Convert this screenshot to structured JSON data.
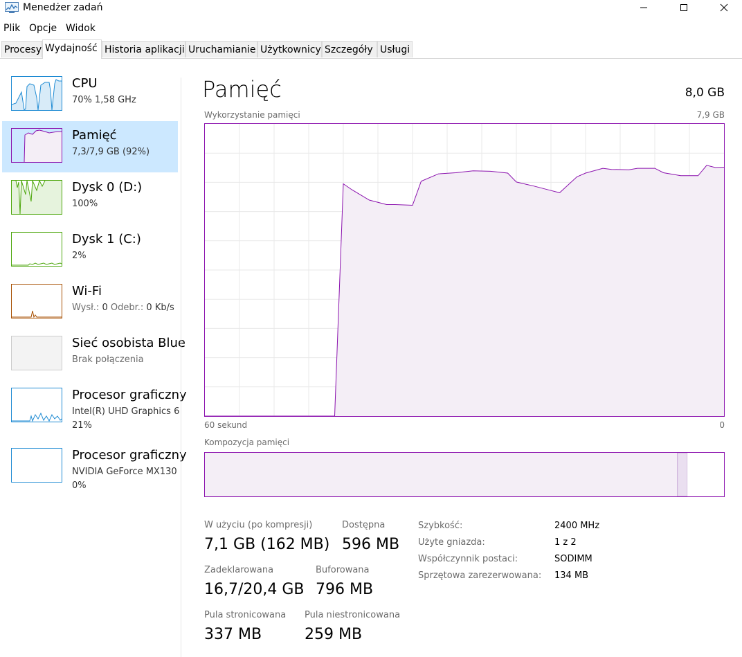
{
  "window": {
    "title": "Menedżer zadań",
    "icon": "task-manager-icon"
  },
  "menu": {
    "items": [
      "Plik",
      "Opcje",
      "Widok"
    ]
  },
  "tabs": {
    "items": [
      "Procesy",
      "Wydajność",
      "Historia aplikacji",
      "Uruchamianie",
      "Użytkownicy",
      "Szczegóły",
      "Usługi"
    ],
    "active": "Wydajność"
  },
  "sidebar": {
    "items": [
      {
        "title": "CPU",
        "sub": "70%  1,58 GHz",
        "color": "#1f8bd3",
        "selected": false
      },
      {
        "title": "Pamięć",
        "sub": "7,3/7,9 GB (92%)",
        "color": "#8b12ae",
        "selected": true
      },
      {
        "title": "Dysk 0 (D:)",
        "sub": "100%",
        "color": "#4da60c",
        "selected": false
      },
      {
        "title": "Dysk 1 (C:)",
        "sub": "2%",
        "color": "#4da60c",
        "selected": false
      },
      {
        "title": "Wi-Fi",
        "sub_label_send": "Wysł.:",
        "sub_val_send": "0",
        "sub_label_recv": "Odebr.:",
        "sub_val_recv": "0 Kb/s",
        "color": "#a74f01",
        "selected": false
      },
      {
        "title": "Sieć osobista Blue",
        "sub": "Brak połączenia",
        "color": "#cccccc",
        "selected": false
      },
      {
        "title": "Procesor graficzny",
        "sub": "Intel(R) UHD Graphics 6",
        "sub2": "21%",
        "color": "#1f8bd3",
        "selected": false
      },
      {
        "title": "Procesor graficzny",
        "sub": "NVIDIA GeForce MX130",
        "sub2": "0%",
        "color": "#1f8bd3",
        "selected": false
      }
    ]
  },
  "main": {
    "title": "Pamięć",
    "total": "8,0 GB",
    "usage_label": "Wykorzystanie pamięci",
    "usage_max": "7,9 GB",
    "x_left": "60 sekund",
    "x_right": "0",
    "composition_label": "Kompozycja pamięci",
    "stats": {
      "in_use_label": "W użyciu (po kompresji)",
      "in_use_value": "7,1 GB (162 MB)",
      "available_label": "Dostępna",
      "available_value": "596 MB",
      "committed_label": "Zadeklarowana",
      "committed_value": "16,7/20,4 GB",
      "cached_label": "Buforowana",
      "cached_value": "796 MB",
      "paged_label": "Pula stronicowana",
      "paged_value": "337 MB",
      "nonpaged_label": "Pula niestronicowana",
      "nonpaged_value": "259 MB"
    },
    "details": [
      {
        "label": "Szybkość:",
        "value": "2400 MHz"
      },
      {
        "label": "Użyte gniazda:",
        "value": "1 z 2"
      },
      {
        "label": "Współczynnik postaci:",
        "value": "SODIMM"
      },
      {
        "label": "Sprzętowa zarezerwowana:",
        "value": "134 MB"
      }
    ]
  },
  "chart_data": {
    "type": "area",
    "x": [
      60,
      45,
      44,
      43,
      41,
      39,
      38,
      36,
      35,
      33,
      31,
      29,
      27,
      25,
      24,
      22,
      20,
      19,
      17,
      16,
      14,
      13,
      11,
      10,
      8,
      7,
      5,
      3,
      2,
      1,
      0
    ],
    "y": [
      0,
      0,
      6.28,
      6.12,
      5.84,
      5.72,
      5.72,
      5.7,
      6.35,
      6.55,
      6.58,
      6.63,
      6.62,
      6.57,
      6.33,
      6.22,
      6.1,
      6.04,
      6.47,
      6.57,
      6.7,
      6.67,
      6.66,
      6.7,
      6.7,
      6.58,
      6.5,
      6.5,
      6.78,
      6.72,
      6.73
    ],
    "xlabel": "60 sekund",
    "ylabel": "Wykorzystanie pamięci",
    "xlim": [
      60,
      0
    ],
    "ylim": [
      0,
      7.9
    ],
    "grid": true,
    "color": "#8b12ae",
    "composition": {
      "in_use": 7.1,
      "modified": 0.15,
      "standby": 0.0,
      "free": 0.55
    }
  }
}
